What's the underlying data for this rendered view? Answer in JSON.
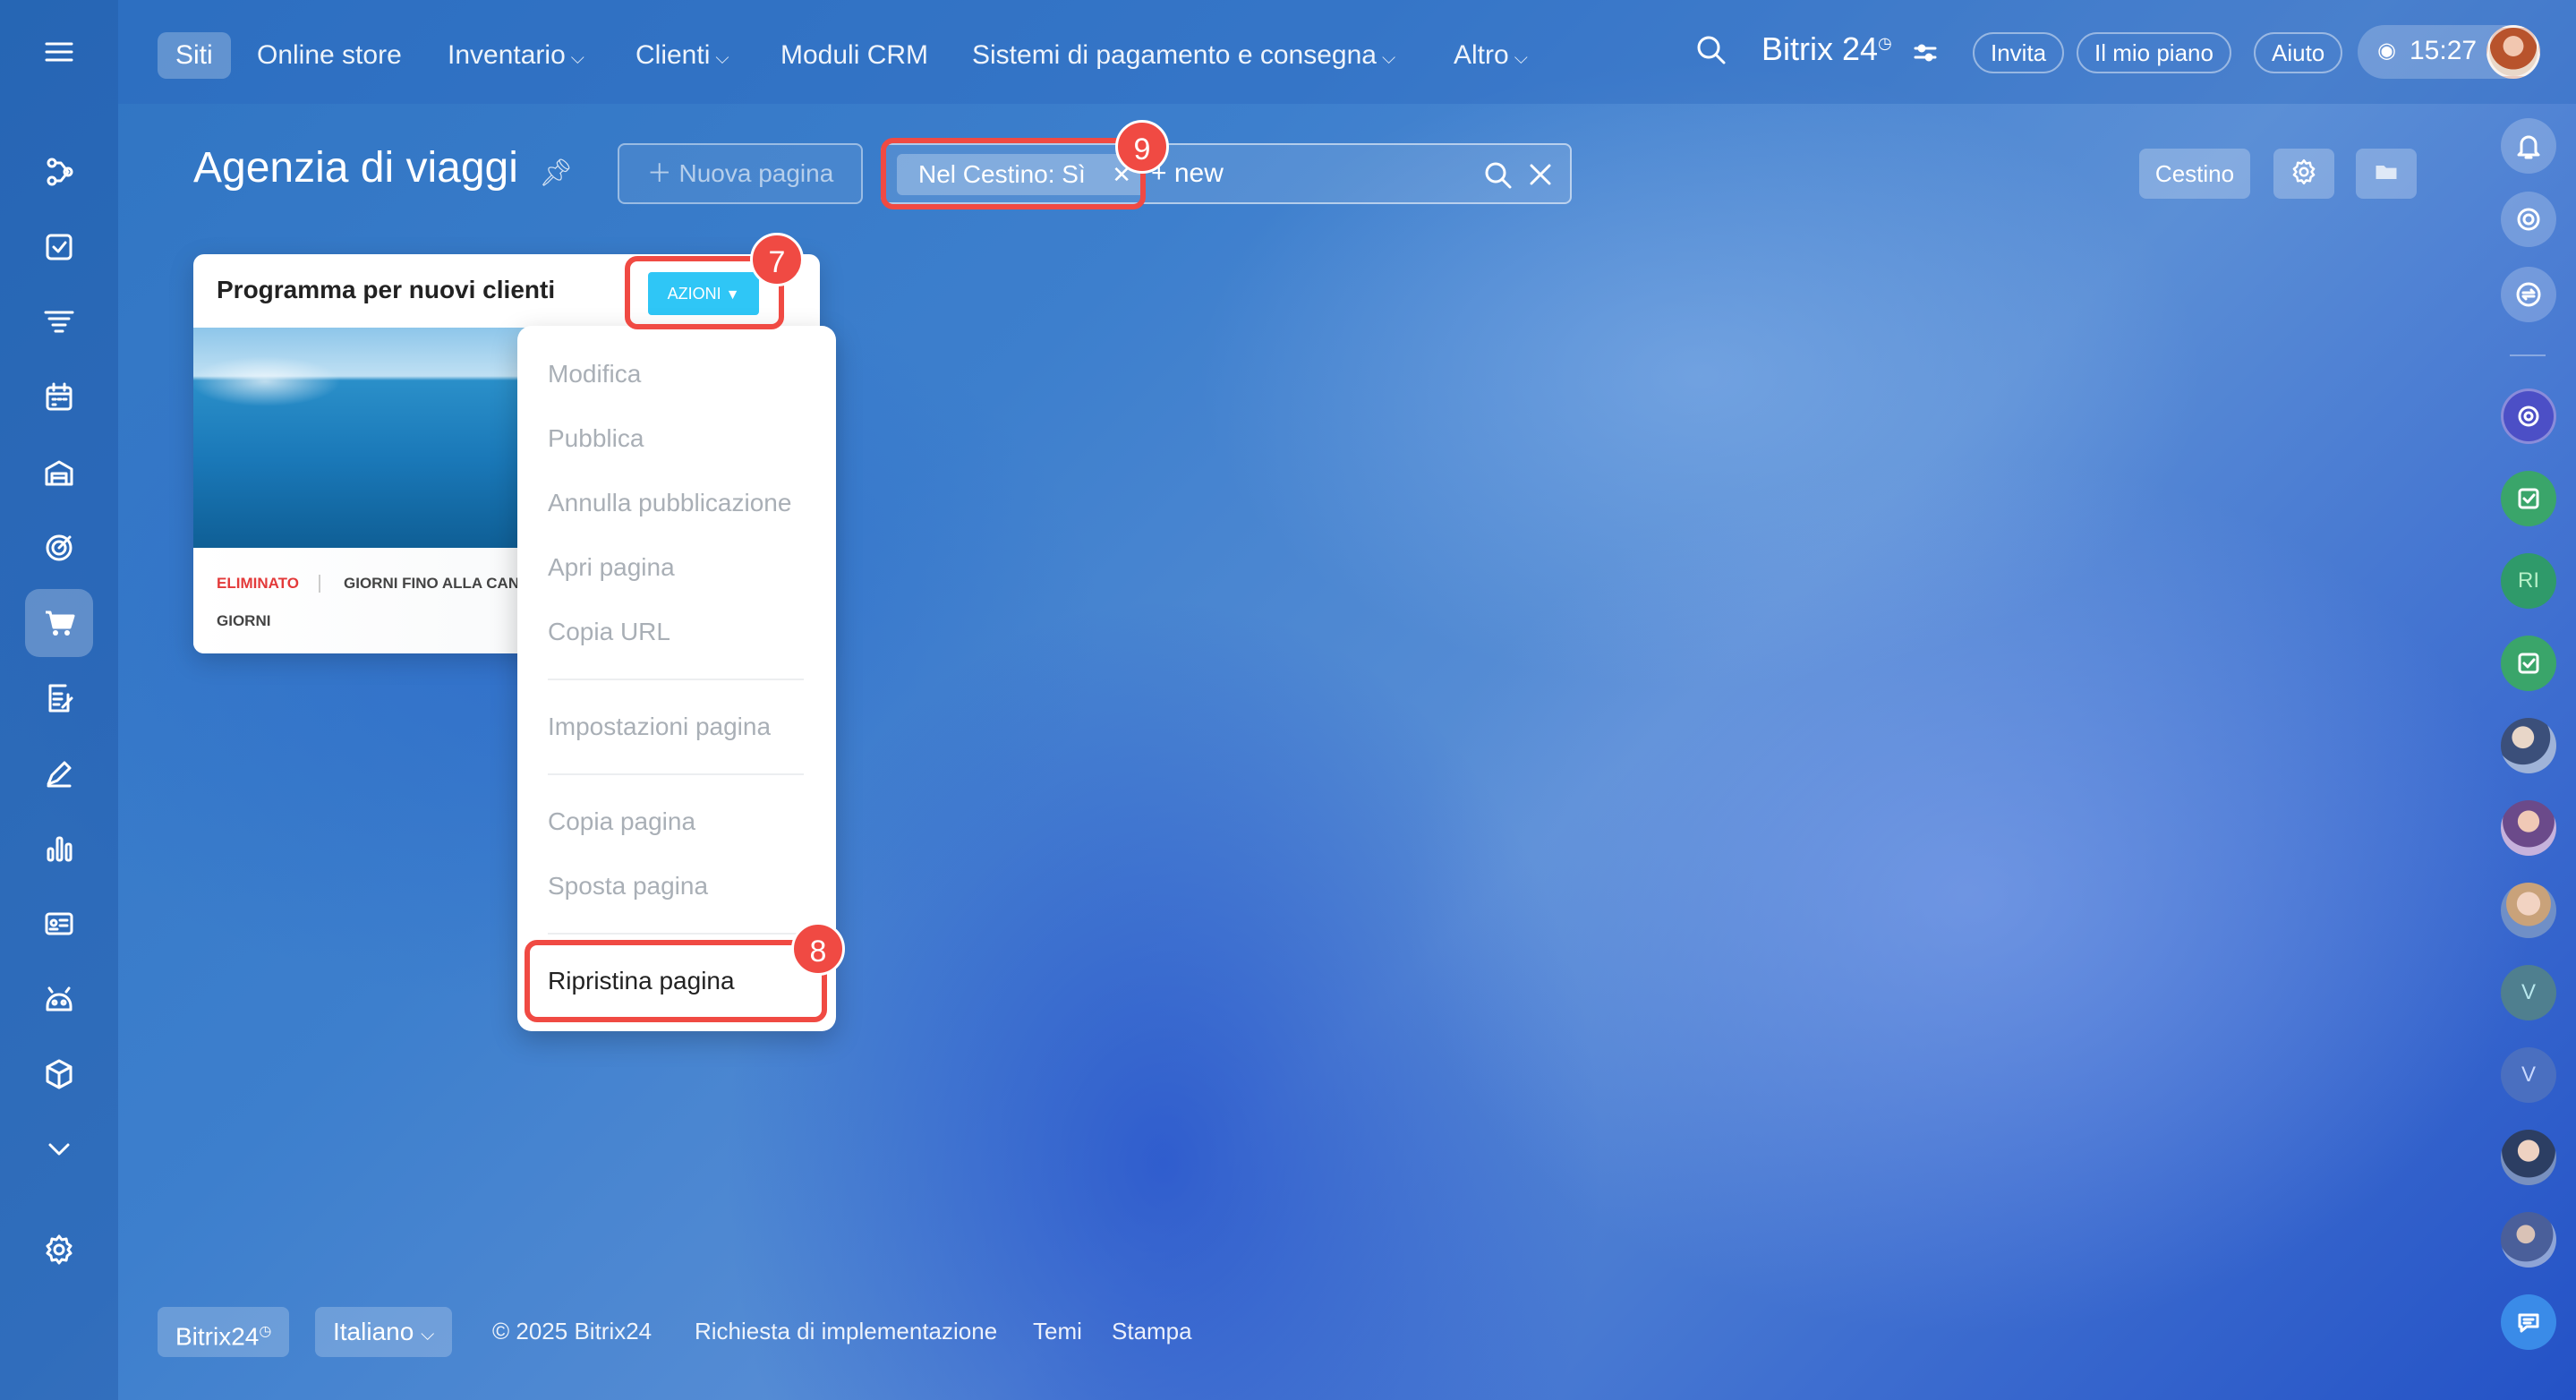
{
  "topbar": {
    "nav": [
      {
        "label": "Siti"
      },
      {
        "label": "Online store"
      },
      {
        "label": "Inventario"
      },
      {
        "label": "Clienti"
      },
      {
        "label": "Moduli CRM"
      },
      {
        "label": "Sistemi di pagamento e consegna"
      },
      {
        "label": "Altro"
      }
    ],
    "logo": "Bitrix 24",
    "invite": "Invita",
    "plan": "Il mio piano",
    "help": "Aiuto",
    "time": "15:27"
  },
  "page": {
    "title": "Agenzia di viaggi",
    "new_page": "Nuova pagina",
    "filter_tag": "Nel Cestino: Sì",
    "search_value": "+ new",
    "trash_button": "Cestino"
  },
  "card": {
    "title": "Programma per nuovi clienti",
    "actions_button": "AZIONI",
    "status": "ELIMINATO",
    "days_label": "GIORNI FINO ALLA CAN",
    "days_unit": "GIORNI"
  },
  "menu": {
    "items": [
      "Modifica",
      "Pubblica",
      "Annulla pubblicazione",
      "Apri pagina",
      "Copia URL",
      "Impostazioni pagina",
      "Copia pagina",
      "Sposta pagina",
      "Ripristina pagina"
    ]
  },
  "badges": {
    "seven": "7",
    "eight": "8",
    "nine": "9"
  },
  "right_sidebar": {
    "letters": [
      "RI",
      "V",
      "V"
    ]
  },
  "footer": {
    "brand": "Bitrix24",
    "language": "Italiano",
    "copyright": "© 2025 Bitrix24",
    "links": [
      "Richiesta di implementazione",
      "Temi",
      "Stampa"
    ]
  },
  "colors": {
    "accent": "#2fc6f6",
    "highlight": "#f04a43",
    "deleted": "#e33a3a"
  }
}
